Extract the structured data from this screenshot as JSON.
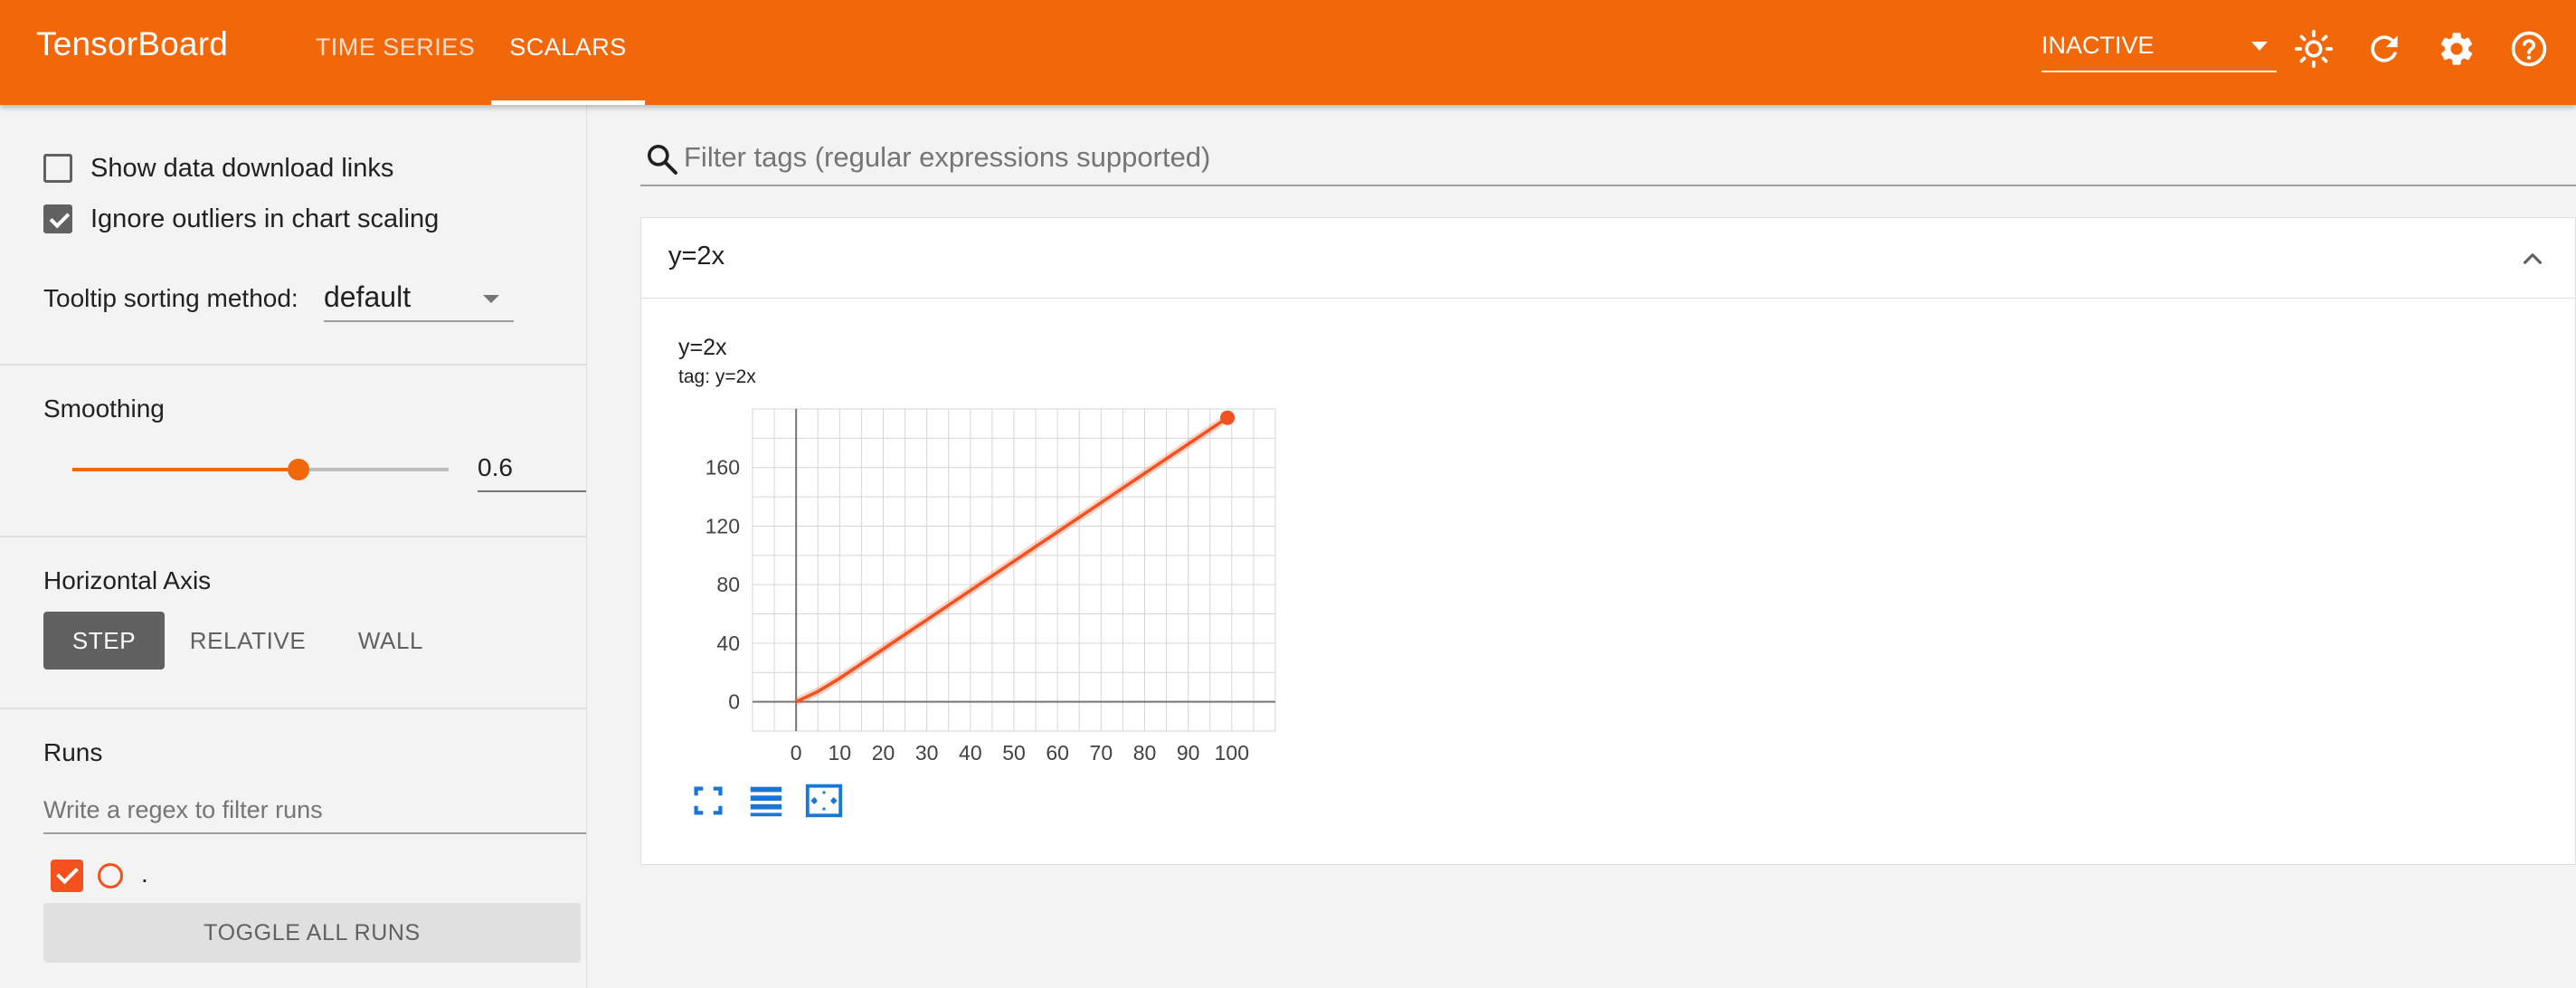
{
  "header": {
    "brand": "TensorBoard",
    "tabs": [
      {
        "label": "TIME SERIES",
        "active": false
      },
      {
        "label": "SCALARS",
        "active": true
      }
    ],
    "status_select": "INACTIVE",
    "icons": [
      "brightness-icon",
      "refresh-icon",
      "settings-icon",
      "help-icon"
    ],
    "colors": {
      "bar": "#f26809"
    }
  },
  "sidebar": {
    "show_download_links": {
      "label": "Show data download links",
      "checked": false
    },
    "ignore_outliers": {
      "label": "Ignore outliers in chart scaling",
      "checked": true
    },
    "tooltip_sorting": {
      "label": "Tooltip sorting method:",
      "value": "default"
    },
    "smoothing": {
      "title": "Smoothing",
      "value": "0.6",
      "fraction": 0.6
    },
    "horizontal_axis": {
      "title": "Horizontal Axis",
      "options": [
        "STEP",
        "RELATIVE",
        "WALL"
      ],
      "selected": "STEP"
    },
    "runs": {
      "title": "Runs",
      "filter_placeholder": "Write a regex to filter runs",
      "items": [
        {
          "name": ".",
          "checked": true,
          "color": "#f4511e"
        }
      ],
      "toggle_all_label": "TOGGLE ALL RUNS"
    }
  },
  "main": {
    "filter_placeholder": "Filter tags (regular expressions supported)",
    "card": {
      "group_title": "y=2x",
      "chart_title": "y=2x",
      "chart_tag": "tag: y=2x",
      "actions": [
        "fullscreen-icon",
        "data-table-icon",
        "fit-domain-icon"
      ]
    }
  },
  "chart_data": {
    "type": "line",
    "title": "y=2x",
    "subtitle": "tag: y=2x",
    "xlabel": "",
    "ylabel": "",
    "x_ticks": [
      0,
      10,
      20,
      30,
      40,
      50,
      60,
      70,
      80,
      90,
      100
    ],
    "y_ticks": [
      0,
      40,
      80,
      120,
      160
    ],
    "xlim": [
      -10,
      110
    ],
    "ylim": [
      -20,
      200
    ],
    "grid": true,
    "series": [
      {
        "name": ".",
        "color": "#f4511e",
        "x": [
          0,
          5,
          10,
          20,
          30,
          40,
          50,
          60,
          70,
          80,
          90,
          99
        ],
        "y": [
          0,
          7,
          16,
          36,
          56,
          76,
          96,
          116,
          136,
          156,
          176,
          194
        ]
      }
    ]
  }
}
